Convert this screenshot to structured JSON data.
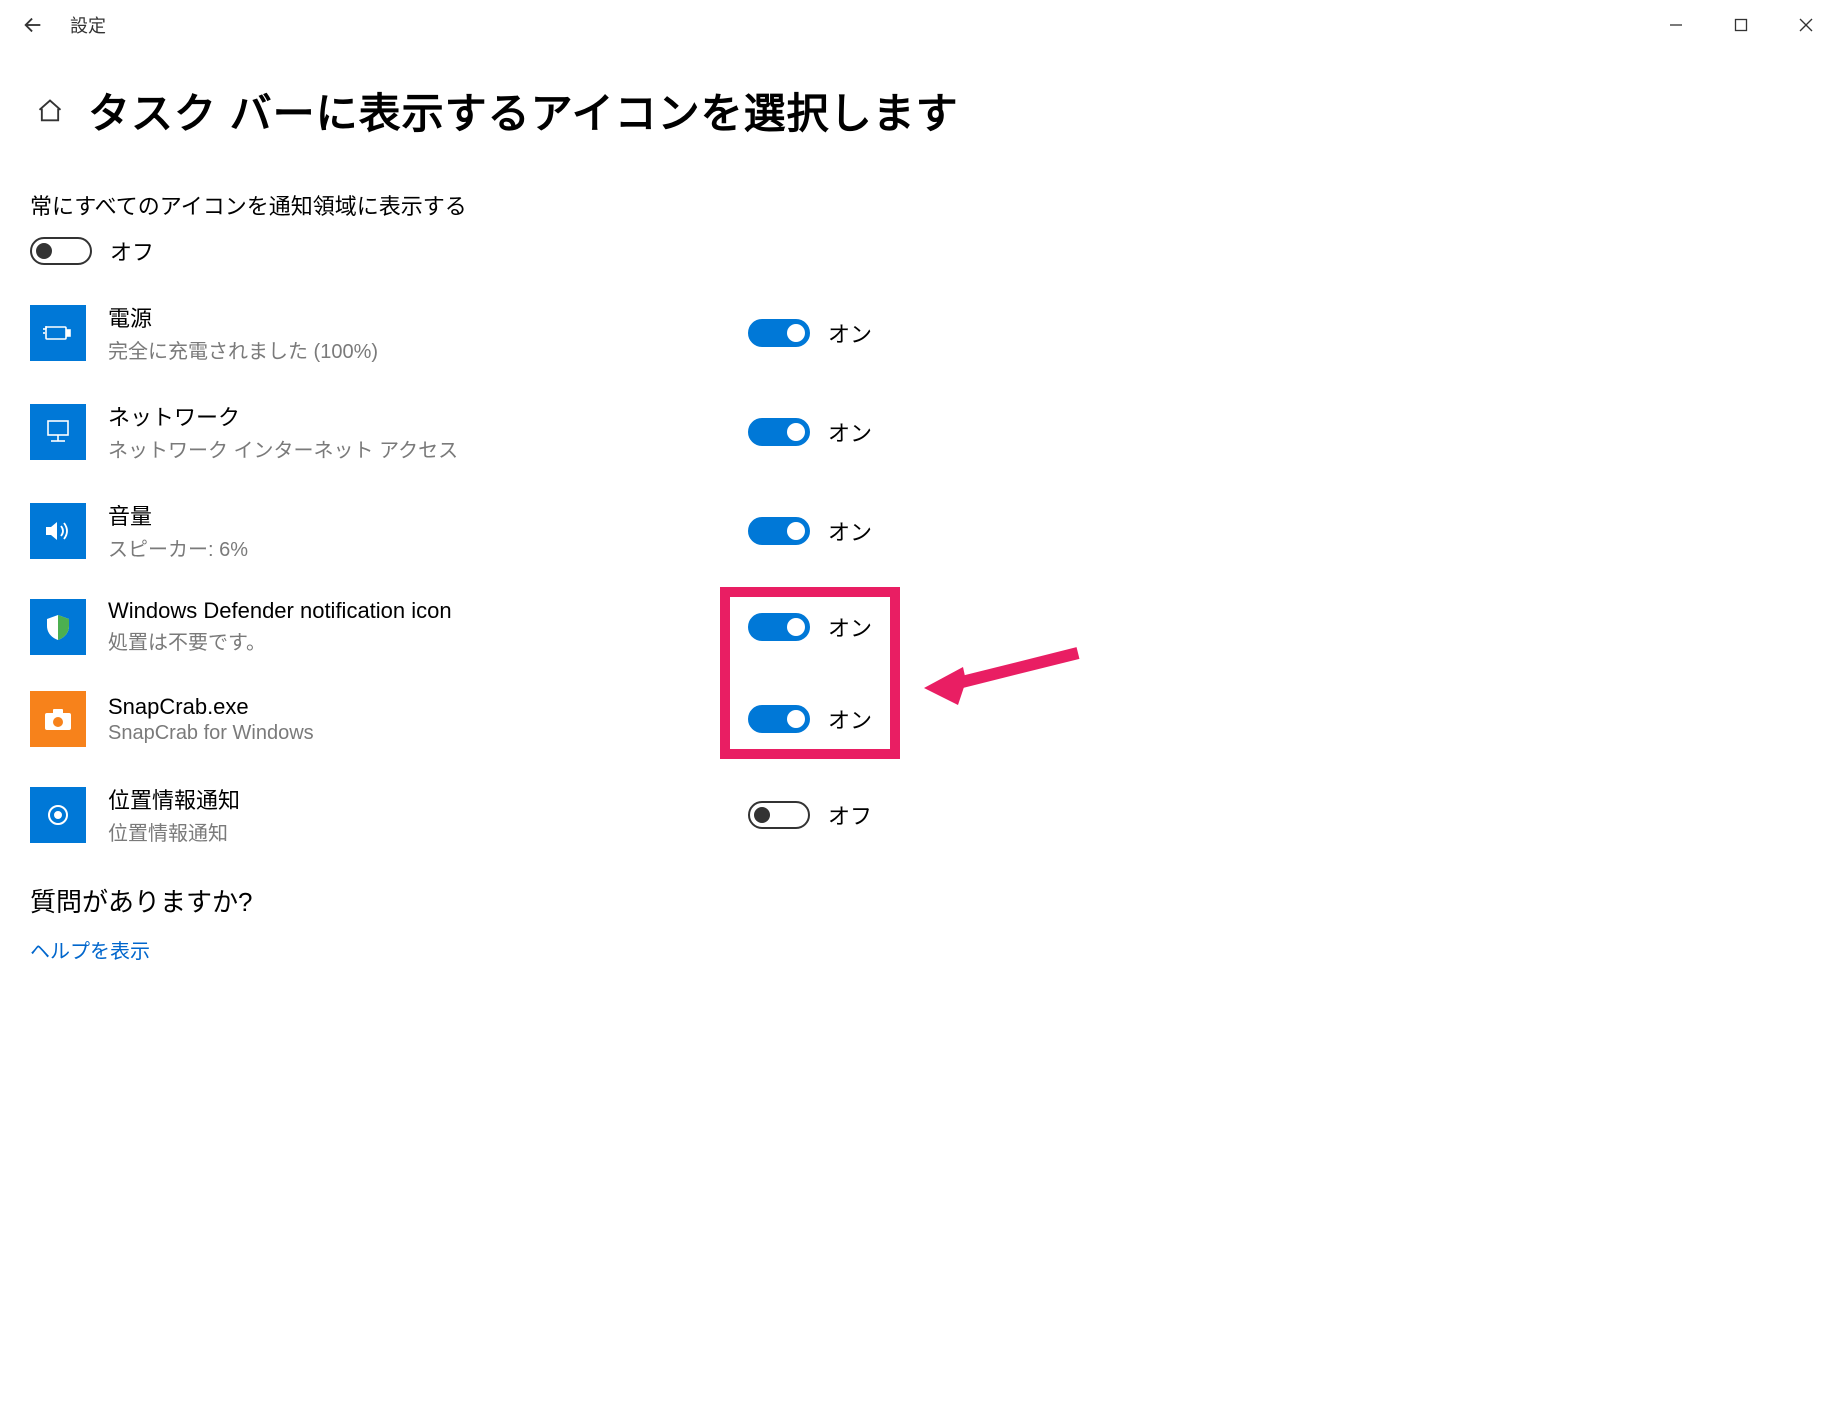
{
  "titlebar": {
    "app_title": "設定"
  },
  "page": {
    "title": "タスク バーに表示するアイコンを選択します"
  },
  "master_toggle": {
    "label": "常にすべてのアイコンを通知領域に表示する",
    "state": "オフ"
  },
  "items": [
    {
      "icon": "battery-icon",
      "title": "電源",
      "subtitle": "完全に充電されました (100%)",
      "state": "オン",
      "on": true
    },
    {
      "icon": "network-icon",
      "title": "ネットワーク",
      "subtitle": "ネットワーク インターネット アクセス",
      "state": "オン",
      "on": true
    },
    {
      "icon": "volume-icon",
      "title": "音量",
      "subtitle": "スピーカー: 6%",
      "state": "オン",
      "on": true
    },
    {
      "icon": "defender-icon",
      "title": "Windows Defender notification icon",
      "subtitle": "処置は不要です。",
      "state": "オン",
      "on": true
    },
    {
      "icon": "snapcrab-icon",
      "title": "SnapCrab.exe",
      "subtitle": "SnapCrab for Windows",
      "state": "オン",
      "on": true
    },
    {
      "icon": "location-icon",
      "title": "位置情報通知",
      "subtitle": "位置情報通知",
      "state": "オフ",
      "on": false
    }
  ],
  "footer": {
    "question_heading": "質問がありますか?",
    "help_link": "ヘルプを表示"
  },
  "annotation": {
    "highlights_items": [
      3,
      4
    ],
    "arrow_color": "#e91e63"
  }
}
